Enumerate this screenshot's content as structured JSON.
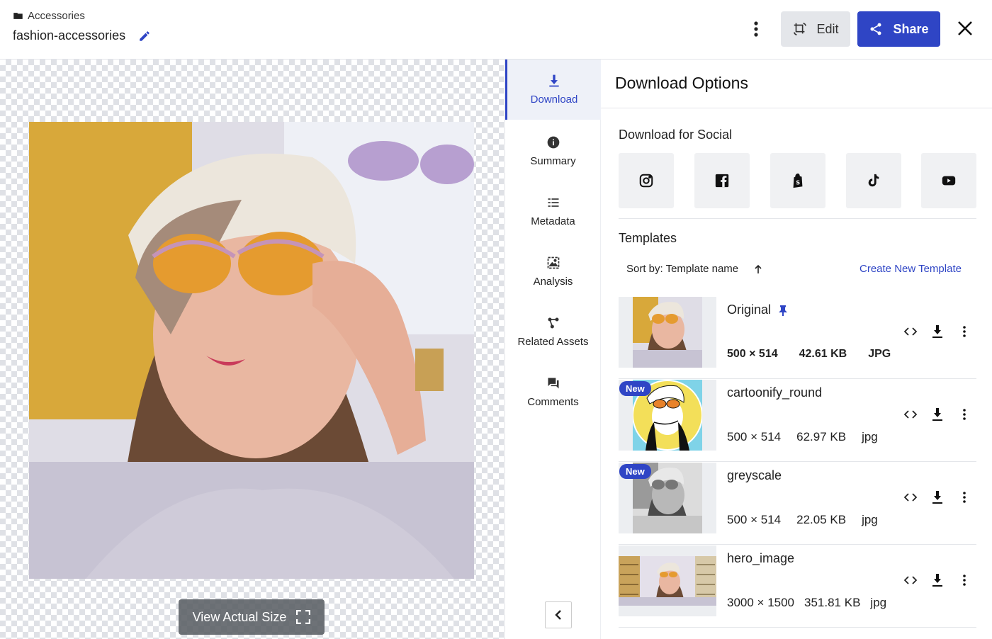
{
  "header": {
    "breadcrumb": "Accessories",
    "asset_name": "fashion-accessories",
    "edit_label": "Edit",
    "share_label": "Share"
  },
  "preview": {
    "view_actual_label": "View Actual Size"
  },
  "rail": {
    "tabs": [
      {
        "label": "Download",
        "icon": "download-icon",
        "active": true
      },
      {
        "label": "Summary",
        "icon": "info-icon"
      },
      {
        "label": "Metadata",
        "icon": "list-icon"
      },
      {
        "label": "Analysis",
        "icon": "image-analysis-icon"
      },
      {
        "label": "Related Assets",
        "icon": "graph-icon"
      },
      {
        "label": "Comments",
        "icon": "chat-icon"
      }
    ]
  },
  "panel": {
    "title": "Download Options",
    "social_title": "Download for Social",
    "social": [
      "instagram-icon",
      "facebook-icon",
      "shopify-icon",
      "tiktok-icon",
      "youtube-icon"
    ],
    "templates_title": "Templates",
    "sort_label": "Sort by: Template name",
    "create_label": "Create New Template",
    "new_badge": "New",
    "templates": [
      {
        "name": "Original",
        "dims": "500 × 514",
        "size": "42.61 KB",
        "format": "JPG",
        "pinned": true
      },
      {
        "name": "cartoonify_round",
        "dims": "500 × 514",
        "size": "62.97 KB",
        "format": "jpg",
        "is_new": true
      },
      {
        "name": "greyscale",
        "dims": "500 × 514",
        "size": "22.05 KB",
        "format": "jpg",
        "is_new": true
      },
      {
        "name": "hero_image",
        "dims": "3000 × 1500",
        "size": "351.81 KB",
        "format": "jpg"
      }
    ]
  },
  "colors": {
    "accent": "#2f45c5",
    "edit_bg": "#e4e6ea",
    "rail_active_bg": "#eef1f8"
  }
}
